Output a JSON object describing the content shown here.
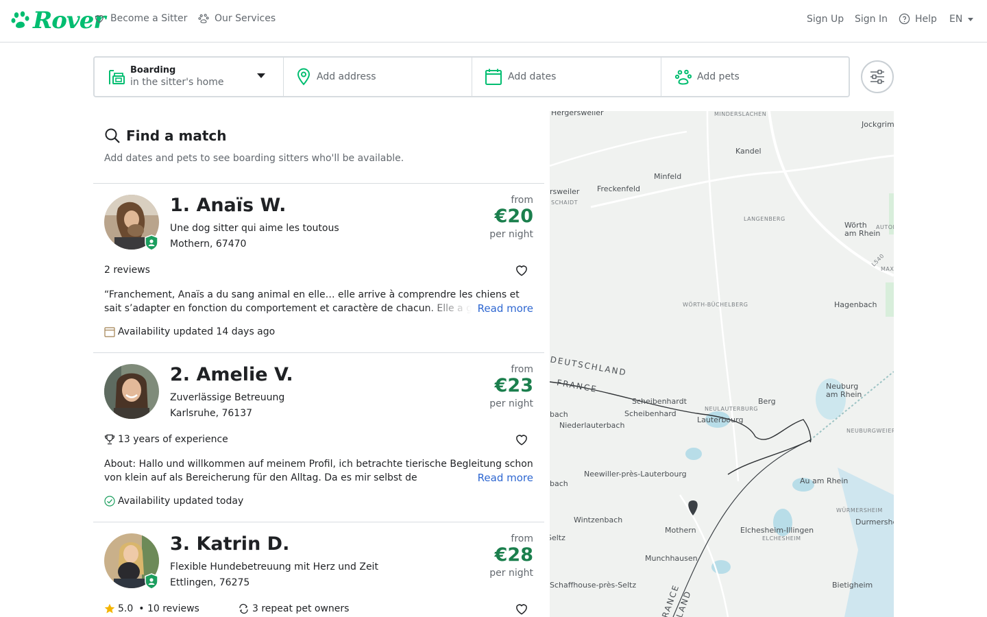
{
  "header": {
    "logo_text": "Rover",
    "nav": [
      {
        "label": "Become a Sitter"
      },
      {
        "label": "Our Services"
      }
    ],
    "sign_up": "Sign Up",
    "sign_in": "Sign In",
    "help": "Help",
    "language": "EN"
  },
  "search": {
    "service_title": "Boarding",
    "service_sub": "in the sitter's home",
    "address_placeholder": "Add address",
    "dates_placeholder": "Add dates",
    "pets_placeholder": "Add pets"
  },
  "find": {
    "title": "Find a match",
    "subtitle": "Add dates and pets to see boarding sitters who'll be available."
  },
  "sitters": [
    {
      "name": "1. Anaïs W.",
      "tagline": "Une dog sitter qui aime les toutous",
      "location": "Mothern, 67470",
      "price_from": "from",
      "price": "€20",
      "price_unit": "per night",
      "reviews": "2 reviews",
      "quote": "“Franchement, Anaïs a du sang animal en elle… elle arrive à comprendre les chiens et sait s’adapter en fonction du comportement et caractère de chacun. Elle a g",
      "read_more": "Read more",
      "availability": "Availability updated 14 days ago"
    },
    {
      "name": "2. Amelie V.",
      "tagline": "Zuverlässige Betreuung",
      "location": "Karlsruhe, 76137",
      "price_from": "from",
      "price": "€23",
      "price_unit": "per night",
      "experience": "13 years of experience",
      "about_label": "About:",
      "quote": "Hallo und willkommen auf meinem Profil, ich betrachte tierische Begleitung schon von klein auf als Bereicherung für den Alltag. Da es mir selbst de",
      "read_more": "Read more",
      "availability": "Availability updated today"
    },
    {
      "name": "3. Katrin D.",
      "tagline": "Flexible Hundebetreuung mit Herz und Zeit",
      "location": "Ettlingen, 76275",
      "price_from": "from",
      "price": "€28",
      "price_unit": "per night",
      "rating": "5.0",
      "reviews": "• 10 reviews",
      "repeat": "3 repeat pet owners"
    }
  ],
  "map": {
    "labels": {
      "hergersweiler": "Hergersweiler",
      "minderslachen": "MINDERSLACHEN",
      "jockgrim": "Jockgrim",
      "kandel": "Kandel",
      "minfeld": "Minfeld",
      "freckenfeld": "Freckenfeld",
      "rsweiler": "rsweiler",
      "schaidt": "SCHAIDT",
      "langenberg": "LANGENBERG",
      "worth": "Wörth\nam Rhein",
      "autom": "AUTOM",
      "l540": "L540",
      "max": "MAX",
      "worth_buchelberg": "WÖRTH-BÜCHELBERG",
      "hagenbach": "Hagenbach",
      "deutschland": "DEUTSCHLAND",
      "france": "FRANCE",
      "scheibenhardt": "Scheibenhardt",
      "scheibenhard": "Scheibenhard",
      "neulauterburg": "NEULAUTERBURG",
      "berg": "Berg",
      "neuburg": "Neuburg\nam Rhein",
      "bach1": "bach",
      "niederlauterbach": "Niederlauterbach",
      "lauterbourg": "Lauterbourg",
      "neuburgweier": "NEUBURGWEIER",
      "neewiller": "Neewiller-près-Lauterbourg",
      "bach2": "bach",
      "au_am_rhein": "Au am Rhein",
      "wurmersheim": "WÜRMERSHEIM",
      "wintzenbach": "Wintzenbach",
      "durmersheim": "Durmershe",
      "mothern": "Mothern",
      "eichesheim": "Elchesheim-Illingen",
      "eichesheim_sm": "ELCHESHEIM",
      "seltz": "Seltz",
      "munchhausen": "Munchhausen",
      "schaffhouse": "Schaffhouse-près-Seltz",
      "bietigheim": "Bietigheim",
      "france2": "FRANCE",
      "land": "LAND"
    }
  },
  "colors": {
    "brand": "#00bd70",
    "price": "#1b7f4d",
    "link": "#2e67d1"
  }
}
